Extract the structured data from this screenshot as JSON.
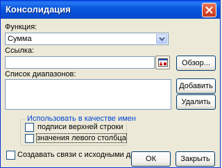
{
  "window": {
    "title": "Консолидация"
  },
  "function": {
    "label": "Функция:",
    "selected": "Сумма"
  },
  "reference": {
    "label": "Ссылка:",
    "value": ""
  },
  "ranges": {
    "label": "Список диапазонов:",
    "items": []
  },
  "buttons": {
    "browse": "Обзор...",
    "add": "Добавить",
    "delete": "Удалить",
    "ok": "ОК",
    "close": "Закрыть"
  },
  "use_labels": {
    "title": "Использовать в качестве имен",
    "top_row": {
      "label": "подписи верхней строки",
      "checked": false
    },
    "left_column": {
      "label": "значения левого столбца",
      "checked": false
    }
  },
  "create_links": {
    "label": "Создавать связи с исходными данными",
    "checked": false
  },
  "colors": {
    "title_bar": "#0a58dd",
    "group_title": "#0046d5",
    "dialog_bg": "#ece9d8"
  }
}
